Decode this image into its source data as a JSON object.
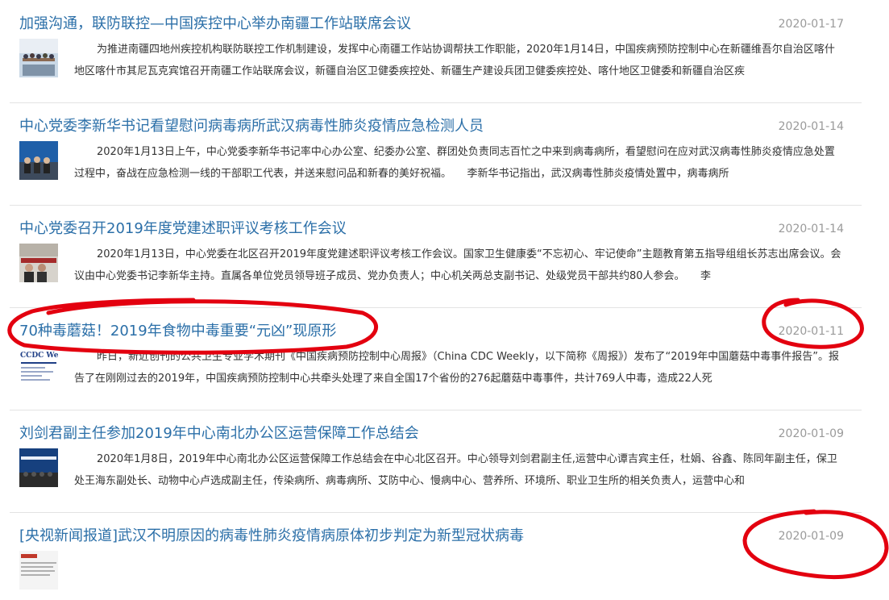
{
  "news": [
    {
      "title": "加强沟通，联防联控—中国疾控中心举办南疆工作站联席会议",
      "date": "2020-01-17",
      "summary": "为推进南疆四地州疾控机构联防联控工作机制建设，发挥中心南疆工作站协调帮扶工作职能，2020年1月14日，中国疾病预防控制中心在新疆维吾尔自治区喀什地区喀什市其尼瓦克宾馆召开南疆工作站联席会议，新疆自治区卫健委疾控处、新疆生产建设兵团卫健委疾控处、喀什地区卫健委和新疆自治区疾",
      "thumb": "meeting-photo"
    },
    {
      "title": "中心党委李新华书记看望慰问病毒病所武汉病毒性肺炎疫情应急检测人员",
      "date": "2020-01-14",
      "summary": "2020年1月13日上午，中心党委李新华书记率中心办公室、纪委办公室、群团处负责同志百忙之中来到病毒病所，看望慰问在应对武汉病毒性肺炎疫情应急处置过程中，奋战在应急检测一线的干部职工代表，并送来慰问品和新春的美好祝福。　　李新华书记指出，武汉病毒性肺炎疫情处置中，病毒病所",
      "thumb": "meeting-photo"
    },
    {
      "title": "中心党委召开2019年度党建述职评议考核工作会议",
      "date": "2020-01-14",
      "summary": "2020年1月13日，中心党委在北区召开2019年度党建述职评议考核工作会议。国家卫生健康委“不忘初心、牢记使命”主题教育第五指导组组长苏志出席会议。会议由中心党委书记李新华主持。直属各单位党员领导班子成员、党办负责人；中心机关两总支副书记、处级党员干部共约80人参会。　　李",
      "thumb": "meeting-photo"
    },
    {
      "title": "70种毒蘑菇！2019年食物中毒重要“元凶”现原形",
      "date": "2020-01-11",
      "summary": "昨日，新近创刊的公共卫生专业学术期刊《中国疾病预防控制中心周报》（China CDC Weekly，以下简称《周报》）发布了“2019年中国蘑菇中毒事件报告”。报告了在刚刚过去的2019年，中国疾病预防控制中心共牵头处理了来自全国17个省份的276起蘑菇中毒事件，共计769人中毒，造成22人死",
      "thumb": "journal-cover",
      "thumb_text": "CCDC Weekly"
    },
    {
      "title": "刘剑君副主任参加2019年中心南北办公区运营保障工作总结会",
      "date": "2020-01-09",
      "summary": "2020年1月8日，2019年中心南北办公区运营保障工作总结会在中心北区召开。中心领导刘剑君副主任,运营中心谭吉宾主任，杜娟、谷鑫、陈同年副主任，保卫处王海东副处长、动物中心卢选成副主任，传染病所、病毒病所、艾防中心、慢病中心、营养所、环境所、职业卫生所的相关负责人，运营中心和",
      "thumb": "stage-photo"
    },
    {
      "title": "[央视新闻报道]武汉不明原因的病毒性肺炎疫情病原体初步判定为新型冠状病毒",
      "date": "2020-01-09",
      "summary": "",
      "thumb": "news-screenshot"
    }
  ],
  "colors": {
    "title": "#2b6fa8",
    "date": "#9a9a9a",
    "summary": "#333333",
    "annotation": "#e3000f"
  }
}
